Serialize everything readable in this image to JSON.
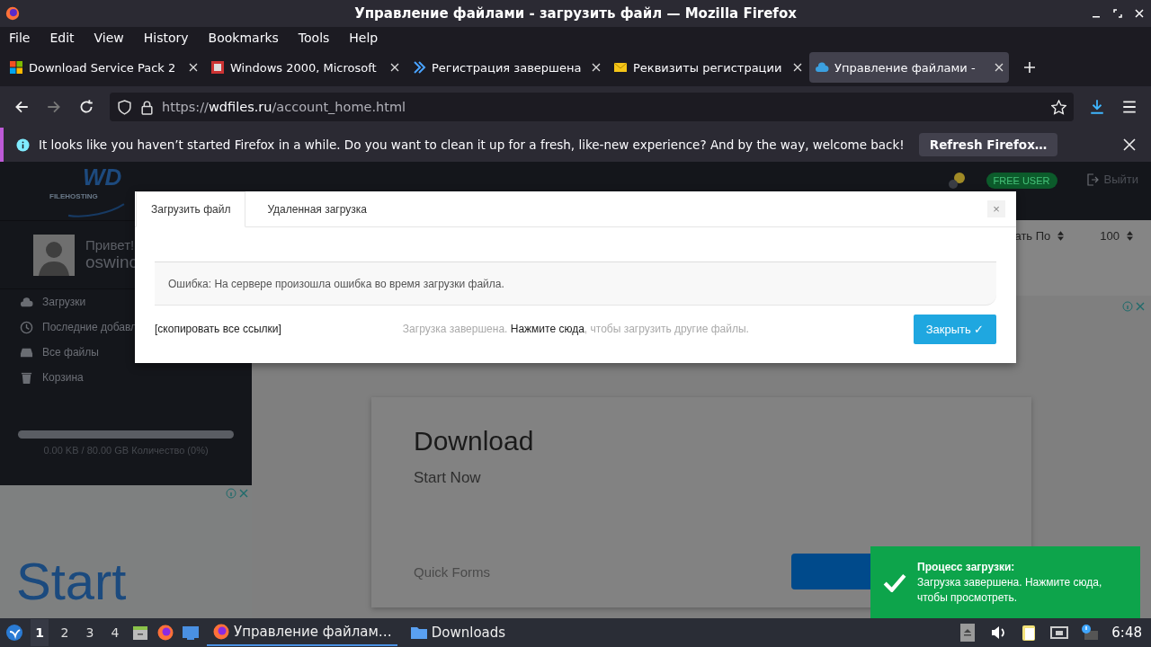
{
  "window": {
    "title": "Управление файлами - загрузить файл — Mozilla Firefox"
  },
  "menu": [
    "File",
    "Edit",
    "View",
    "History",
    "Bookmarks",
    "Tools",
    "Help"
  ],
  "tabs": [
    {
      "label": "Download Service Pack 2",
      "kind": "windows",
      "selected": false
    },
    {
      "label": "Windows 2000, Microsoft",
      "kind": "image",
      "selected": false
    },
    {
      "label": "Регистрация завершена",
      "kind": "chevron",
      "selected": false
    },
    {
      "label": "Реквизиты регистрации",
      "kind": "mail",
      "selected": false
    },
    {
      "label": "Управление файлами -",
      "kind": "cloud",
      "selected": true
    }
  ],
  "address": {
    "scheme": "https://",
    "domain": "wdfiles.ru",
    "path": "/account_home.html"
  },
  "notification": {
    "text": "It looks like you haven’t started Firefox in a while. Do you want to clean it up for a fresh, like-new experience? And by the way, welcome back!",
    "button": "Refresh Firefox…"
  },
  "site": {
    "logo": {
      "mark": "WD",
      "subtitle": "FILEHOSTING"
    },
    "user": {
      "greeting": "Привет!",
      "name": "oswinc"
    },
    "sidebar": [
      {
        "label": "Загрузки",
        "kind": "upload"
      },
      {
        "label": "Последние добавл",
        "kind": "clock"
      },
      {
        "label": "Все файлы",
        "kind": "drive"
      },
      {
        "label": "Корзина",
        "kind": "trash"
      }
    ],
    "storage": {
      "text": "0.00 KB / 80.00 GB Количество (0%)"
    },
    "account_badge": "FREE USER",
    "logout": "Выйти",
    "sort_selects": [
      "ать По",
      "100"
    ],
    "ad_left": {
      "headline": "Start"
    },
    "ad_main": {
      "title": "Download",
      "subtitle": "Start Now",
      "footer": "Quick Forms"
    }
  },
  "modal": {
    "tabs": [
      {
        "label": "Загрузить файл",
        "selected": true
      },
      {
        "label": "Удаленная загрузка",
        "selected": false
      }
    ],
    "close": "×",
    "error": "Ошибка: На сервере произошла ошибка во время загрузки файла.",
    "copy_links": "[скопировать все ссылки]",
    "status": {
      "before": "Загрузка завершена. ",
      "link": "Нажмите сюда",
      "after": ", чтобы загрузить другие файлы."
    },
    "button": "Закрыть ✓"
  },
  "toast": {
    "title": "Процесс загрузки:",
    "text": "Загрузка завершена. Нажмите сюда, чтобы просмотреть."
  },
  "taskbar": {
    "workspaces": [
      {
        "label": "1",
        "selected": true
      },
      {
        "label": "2",
        "selected": false
      },
      {
        "label": "3",
        "selected": false
      },
      {
        "label": "4",
        "selected": false
      }
    ],
    "tasks": [
      {
        "label": "Управление файлам…",
        "kind": "firefox",
        "selected": true
      },
      {
        "label": "Downloads",
        "kind": "folder",
        "selected": false
      }
    ],
    "clock": "6:48"
  }
}
